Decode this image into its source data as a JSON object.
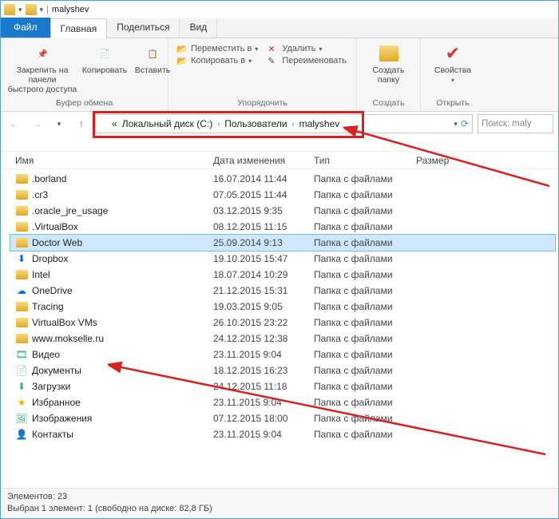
{
  "title": "malyshev",
  "tabs": {
    "file": "Файл",
    "home": "Главная",
    "share": "Поделиться",
    "view": "Вид"
  },
  "ribbon": {
    "pin": "Закрепить на панели\nбыстрого доступа",
    "copy": "Копировать",
    "paste": "Вставить",
    "group1": "Буфер обмена",
    "moveTo": "Переместить в",
    "copyTo": "Копировать в",
    "delete": "Удалить",
    "rename": "Переименовать",
    "group2": "Упорядочить",
    "newFolder": "Создать\nпапку",
    "group3": "Создать",
    "props": "Свойства",
    "group4": "Открыть"
  },
  "breadcrumbs": [
    "Локальный диск (C:)",
    "Пользователи",
    "malyshev"
  ],
  "searchPlaceholder": "Поиск: maly",
  "columns": {
    "name": "Имя",
    "date": "Дата изменения",
    "type": "Тип",
    "size": "Размер"
  },
  "folderType": "Папка с файлами",
  "items": [
    {
      "name": ".borland",
      "date": "16.07.2014 11:44",
      "icon": "folder"
    },
    {
      "name": ".cr3",
      "date": "07.05.2015 11:44",
      "icon": "folder"
    },
    {
      "name": ".oracle_jre_usage",
      "date": "03.12.2015 9:35",
      "icon": "folder"
    },
    {
      "name": ".VirtualBox",
      "date": "08.12.2015 11:15",
      "icon": "folder"
    },
    {
      "name": "Doctor Web",
      "date": "25.09.2014 9:13",
      "icon": "folder",
      "selected": true
    },
    {
      "name": "Dropbox",
      "date": "19.10.2015 15:47",
      "icon": "dropbox"
    },
    {
      "name": "Intel",
      "date": "18.07.2014 10:29",
      "icon": "folder"
    },
    {
      "name": "OneDrive",
      "date": "21.12.2015 15:31",
      "icon": "onedrive"
    },
    {
      "name": "Tracing",
      "date": "19.03.2015 9:05",
      "icon": "folder"
    },
    {
      "name": "VirtualBox VMs",
      "date": "26.10.2015 23:22",
      "icon": "folder"
    },
    {
      "name": "www.mokselle.ru",
      "date": "24.12.2015 12:38",
      "icon": "folder"
    },
    {
      "name": "Видео",
      "date": "23.11.2015 9:04",
      "icon": "video"
    },
    {
      "name": "Документы",
      "date": "18.12.2015 16:23",
      "icon": "docs"
    },
    {
      "name": "Загрузки",
      "date": "24.12.2015 11:18",
      "icon": "downloads"
    },
    {
      "name": "Избранное",
      "date": "23.11.2015 9:04",
      "icon": "fav"
    },
    {
      "name": "Изображения",
      "date": "07.12.2015 18:00",
      "icon": "pics"
    },
    {
      "name": "Контакты",
      "date": "23.11.2015 9:04",
      "icon": "contacts"
    }
  ],
  "status1": "Элементов: 23",
  "status2": "Выбран 1 элемент: 1 (свободно на диске: 82,8 ГБ)"
}
